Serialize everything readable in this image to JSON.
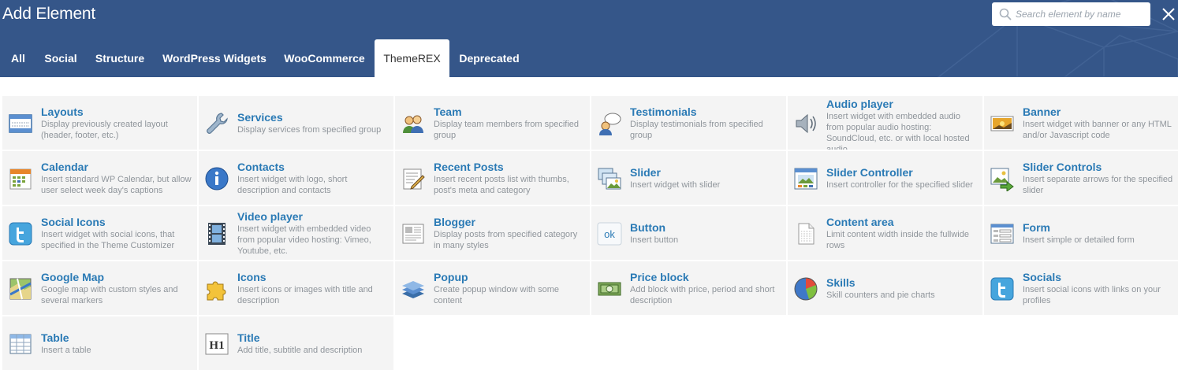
{
  "header": {
    "title": "Add Element",
    "search_placeholder": "Search element by name",
    "close_label": "×"
  },
  "tabs": [
    {
      "label": "All",
      "active": false
    },
    {
      "label": "Social",
      "active": false
    },
    {
      "label": "Structure",
      "active": false
    },
    {
      "label": "WordPress Widgets",
      "active": false
    },
    {
      "label": "WooCommerce",
      "active": false
    },
    {
      "label": "ThemeREX",
      "active": true
    },
    {
      "label": "Deprecated",
      "active": false
    }
  ],
  "elements": [
    {
      "title": "Layouts",
      "desc": "Display previously created layout (header, footer, etc.)",
      "icon": "layouts-icon"
    },
    {
      "title": "Services",
      "desc": "Display services from specified group",
      "icon": "wrench-icon"
    },
    {
      "title": "Team",
      "desc": "Display team members from specified group",
      "icon": "team-icon"
    },
    {
      "title": "Testimonials",
      "desc": "Display testimonials from specified group",
      "icon": "speech-bubble-icon"
    },
    {
      "title": "Audio player",
      "desc": "Insert widget with embedded audio from popular audio hosting: SoundCloud, etc. or with local hosted audio",
      "icon": "speaker-icon"
    },
    {
      "title": "Banner",
      "desc": "Insert widget with banner or any HTML and/or Javascript code",
      "icon": "banner-icon"
    },
    {
      "title": "Calendar",
      "desc": "Insert standard WP Calendar, but allow user select week day's captions",
      "icon": "calendar-icon"
    },
    {
      "title": "Contacts",
      "desc": "Insert widget with logo, short description and contacts",
      "icon": "info-icon"
    },
    {
      "title": "Recent Posts",
      "desc": "Insert recent posts list with thumbs, post's meta and category",
      "icon": "post-edit-icon"
    },
    {
      "title": "Slider",
      "desc": "Insert widget with slider",
      "icon": "slider-icon"
    },
    {
      "title": "Slider Controller",
      "desc": "Insert controller for the specified slider",
      "icon": "slider-controller-icon"
    },
    {
      "title": "Slider Controls",
      "desc": "Insert separate arrows for the specified slider",
      "icon": "slider-controls-icon"
    },
    {
      "title": "Social Icons",
      "desc": "Insert widget with social icons, that specified in the Theme Customizer",
      "icon": "twitter-icon"
    },
    {
      "title": "Video player",
      "desc": "Insert widget with embedded video from popular video hosting: Vimeo, Youtube, etc.",
      "icon": "film-icon"
    },
    {
      "title": "Blogger",
      "desc": "Display posts from specified category in many styles",
      "icon": "newspaper-icon"
    },
    {
      "title": "Button",
      "desc": "Insert button",
      "icon": "ok-button-icon"
    },
    {
      "title": "Content area",
      "desc": "Limit content width inside the fullwide rows",
      "icon": "document-icon"
    },
    {
      "title": "Form",
      "desc": "Insert simple or detailed form",
      "icon": "form-icon"
    },
    {
      "title": "Google Map",
      "desc": "Google map with custom styles and several markers",
      "icon": "map-icon"
    },
    {
      "title": "Icons",
      "desc": "Insert icons or images with title and description",
      "icon": "puzzle-icon"
    },
    {
      "title": "Popup",
      "desc": "Create popup window with some content",
      "icon": "layers-icon"
    },
    {
      "title": "Price block",
      "desc": "Add block with price, period and short description",
      "icon": "money-icon"
    },
    {
      "title": "Skills",
      "desc": "Skill counters and pie charts",
      "icon": "pie-chart-icon"
    },
    {
      "title": "Socials",
      "desc": "Insert social icons with links on your profiles",
      "icon": "twitter-icon"
    },
    {
      "title": "Table",
      "desc": "Insert a table",
      "icon": "table-icon"
    },
    {
      "title": "Title",
      "desc": "Add title, subtitle and description",
      "icon": "heading-icon"
    }
  ]
}
